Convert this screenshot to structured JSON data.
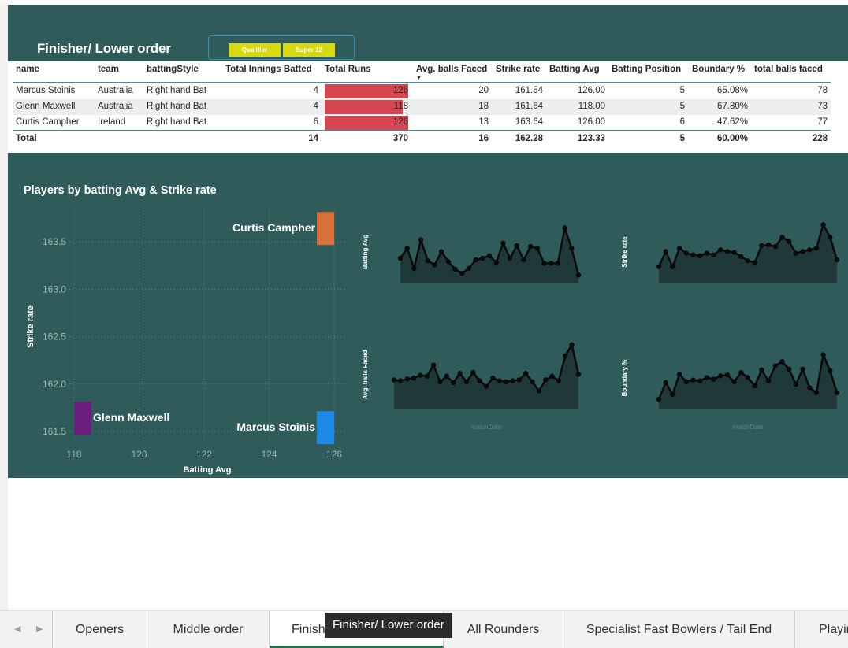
{
  "page": {
    "title": "Finisher/ Lower order",
    "slicers": [
      "Qualifier",
      "Super 12"
    ]
  },
  "table": {
    "headers": [
      "name",
      "team",
      "battingStyle",
      "Total Innings Batted",
      "Total Runs",
      "Avg. balls Faced",
      "Strike rate",
      "Batting Avg",
      "Batting Position",
      "Boundary %",
      "total balls faced"
    ],
    "rows": [
      {
        "name": "Marcus Stoinis",
        "team": "Australia",
        "style": "Right hand Bat",
        "innings": "4",
        "runs": "126",
        "balls": "20",
        "sr": "161.54",
        "avg": "126.00",
        "pos": "5",
        "boundary": "65.08%",
        "total_balls": "78",
        "runs_frac": 1.0
      },
      {
        "name": "Glenn Maxwell",
        "team": "Australia",
        "style": "Right hand Bat",
        "innings": "4",
        "runs": "118",
        "balls": "18",
        "sr": "161.64",
        "avg": "118.00",
        "pos": "5",
        "boundary": "67.80%",
        "total_balls": "73",
        "runs_frac": 0.937
      },
      {
        "name": "Curtis Campher",
        "team": "Ireland",
        "style": "Right hand Bat",
        "innings": "6",
        "runs": "126",
        "balls": "13",
        "sr": "163.64",
        "avg": "126.00",
        "pos": "6",
        "boundary": "47.62%",
        "total_balls": "77",
        "runs_frac": 1.0
      }
    ],
    "total": {
      "label": "Total",
      "innings": "14",
      "runs": "370",
      "balls": "16",
      "sr": "162.28",
      "avg": "123.33",
      "pos": "5",
      "boundary": "60.00%",
      "total_balls": "228"
    }
  },
  "chart_data": [
    {
      "type": "scatter",
      "title": "Players by batting Avg & Strike rate",
      "xlabel": "Batting Avg",
      "ylabel": "Strike rate",
      "xlim": [
        118,
        126
      ],
      "ylim": [
        161.5,
        163.7
      ],
      "xticks": [
        "118",
        "120",
        "122",
        "124",
        "126"
      ],
      "yticks": [
        "161.5",
        "162.0",
        "162.5",
        "163.0",
        "163.5"
      ],
      "grid": true,
      "points": [
        {
          "label": "Glenn Maxwell",
          "x": 118,
          "y": 161.64,
          "color": "#6b1f7c"
        },
        {
          "label": "Marcus Stoinis",
          "x": 126,
          "y": 161.54,
          "color": "#1e88e5"
        },
        {
          "label": "Curtis Campher",
          "x": 126,
          "y": 163.64,
          "color": "#d8703a"
        }
      ]
    },
    {
      "type": "area",
      "ylabel": "Batting Avg",
      "values": [
        30,
        42,
        18,
        52,
        27,
        22,
        38,
        26,
        17,
        12,
        18,
        28,
        30,
        33,
        25,
        48,
        30,
        45,
        28,
        44,
        42,
        24,
        24,
        24,
        66,
        42,
        10
      ]
    },
    {
      "type": "area",
      "ylabel": "Strike rate",
      "values": [
        20,
        38,
        20,
        42,
        36,
        34,
        33,
        36,
        34,
        40,
        38,
        37,
        32,
        27,
        25,
        45,
        46,
        44,
        55,
        50,
        36,
        38,
        40,
        42,
        70,
        55,
        28
      ]
    },
    {
      "type": "area",
      "ylabel": "Avg. balls Faced",
      "values": [
        32,
        31,
        33,
        34,
        37,
        36,
        48,
        30,
        36,
        29,
        39,
        30,
        40,
        31,
        25,
        34,
        31,
        30,
        31,
        32,
        39,
        30,
        20,
        32,
        36,
        31,
        58,
        70,
        38
      ]
    },
    {
      "type": "area",
      "xlabel": "matchDate",
      "ylabel": "Boundary %",
      "values": [
        12,
        32,
        18,
        42,
        33,
        35,
        34,
        38,
        36,
        40,
        41,
        33,
        44,
        38,
        28,
        47,
        34,
        52,
        57,
        48,
        30,
        48,
        26,
        20,
        65,
        46,
        20
      ]
    }
  ],
  "tabs": [
    {
      "label": "Openers",
      "active": false
    },
    {
      "label": "Middle order",
      "active": false
    },
    {
      "label": "Finisher/ Lower order",
      "active": true
    },
    {
      "label": "All Rounders",
      "active": false
    },
    {
      "label": "Specialist Fast Bowlers / Tail End",
      "active": false
    },
    {
      "label": "Playing",
      "active": false
    }
  ],
  "tooltip": "Finisher/ Lower order",
  "colors": {
    "panel": "#2f5c5a",
    "runs_bar": "#d64550",
    "accent": "#3a8fb0",
    "slicer": "#d9d90f",
    "tab_active": "#217346"
  }
}
